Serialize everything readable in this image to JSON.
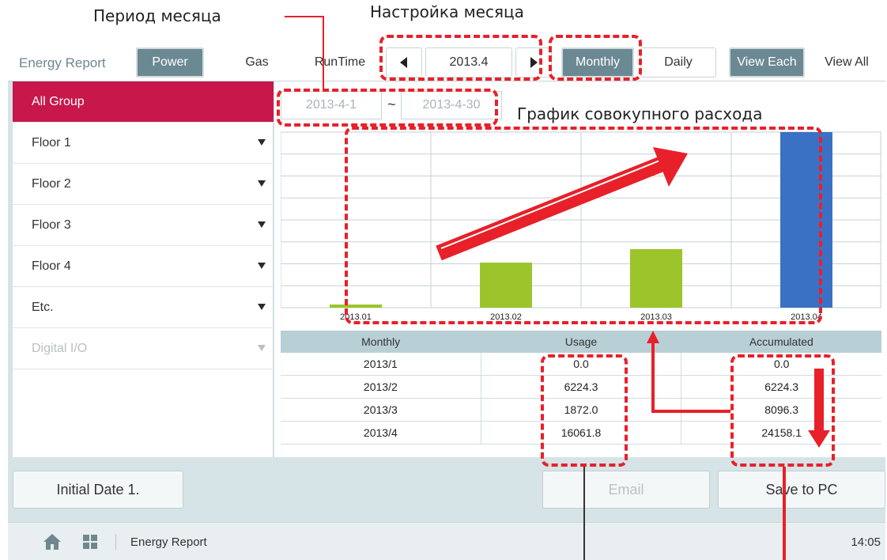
{
  "annotations": {
    "period_label": "Период месяца",
    "month_setting_label": "Настройка месяца",
    "cumulative_label": "График совокупного расхода"
  },
  "toolbar": {
    "title": "Energy Report",
    "tabs": [
      "Power",
      "Gas",
      "RunTime"
    ],
    "current_month": "2013.4",
    "modes": [
      "Monthly",
      "Daily"
    ],
    "views": [
      "View Each",
      "View All"
    ]
  },
  "sidebar": {
    "items": [
      "All Group",
      "Floor 1",
      "Floor 2",
      "Floor 3",
      "Floor 4",
      "Etc.",
      "Digital I/O"
    ]
  },
  "period": {
    "start": "2013-4-1",
    "separator": "~",
    "end": "2013-4-30"
  },
  "chart_data": {
    "type": "bar",
    "categories": [
      "2013.01",
      "2013.02",
      "2013.03",
      "2013.04"
    ],
    "values": [
      0.0,
      6224.3,
      8096.3,
      24158.1
    ],
    "colors": [
      "#9bc52a",
      "#9bc52a",
      "#9bc52a",
      "#3b71c4"
    ],
    "ylim": [
      0,
      24158.1
    ],
    "grid": true
  },
  "table": {
    "headers": [
      "Monthly",
      "Usage",
      "Accumulated"
    ],
    "rows": [
      [
        "2013/1",
        "0.0",
        "0.0"
      ],
      [
        "2013/2",
        "6224.3",
        "6224.3"
      ],
      [
        "2013/3",
        "1872.0",
        "8096.3"
      ],
      [
        "2013/4",
        "16061.8",
        "24158.1"
      ]
    ]
  },
  "buttons": {
    "initial_date": "Initial Date 1.",
    "email": "Email",
    "save": "Save to PC"
  },
  "footer": {
    "title": "Energy Report",
    "time": "14:05"
  },
  "colors": {
    "accent": "#c8174a",
    "selected": "#6b8993",
    "annotation": "#e8202a"
  },
  "icons": [
    "home-icon",
    "grid-icon",
    "arrow-left-icon",
    "arrow-right-icon",
    "dropdown-arrow-icon"
  ]
}
